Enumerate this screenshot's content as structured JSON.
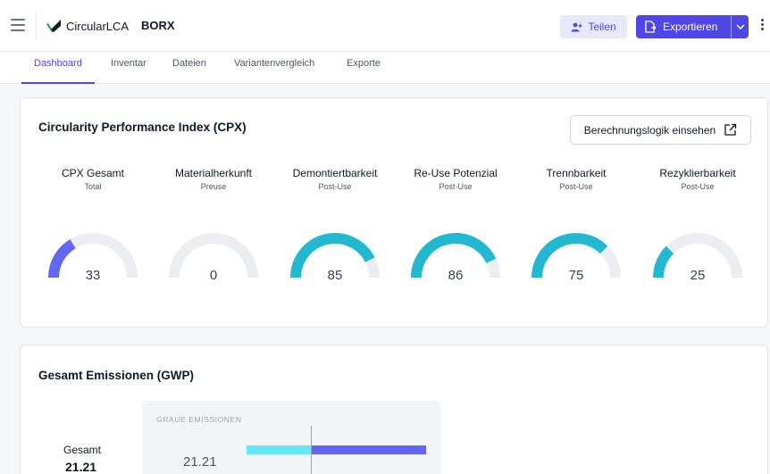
{
  "header": {
    "app_name": "CircularLCA",
    "project_name": "BORX",
    "share_label": "Teilen",
    "export_label": "Exportieren",
    "icons": [
      "menu-icon",
      "logo-icon",
      "share-user-icon",
      "export-file-icon",
      "chevron-down-icon",
      "more-vertical-icon"
    ],
    "accent_color": "#4f46e5"
  },
  "tabs": [
    {
      "label": "Dashboard",
      "active": true
    },
    {
      "label": "Inventar"
    },
    {
      "label": "Dateien"
    },
    {
      "label": "Variantenvergleich"
    },
    {
      "label": "Exporte"
    }
  ],
  "cpx": {
    "title": "Circularity Performance Index (CPX)",
    "logic_button": "Berechnungslogik einsehen",
    "gauges": [
      {
        "label": "CPX Gesamt",
        "sub": "Total",
        "value": "33",
        "color": "#6366f1"
      },
      {
        "label": "Materialherkunft",
        "sub": "Preuse",
        "value": "0",
        "color": "#22b8cf"
      },
      {
        "label": "Demontiertbarkeit",
        "sub": "Post-Use",
        "value": "85",
        "color": "#22b8cf"
      },
      {
        "label": "Re-Use Potenzial",
        "sub": "Post-Use",
        "value": "86",
        "color": "#22b8cf"
      },
      {
        "label": "Trennbarkeit",
        "sub": "Post-Use",
        "value": "75",
        "color": "#22b8cf"
      },
      {
        "label": "Rezyklierbarkeit",
        "sub": "Post-Use",
        "value": "25",
        "color": "#22b8cf"
      }
    ]
  },
  "emissions": {
    "title": "Gesamt Emissionen (GWP)",
    "gesamt_label": "Gesamt",
    "gesamt_value": "21.21",
    "panel_title": "GRAUE EMISSIONEN",
    "panel_value": "21.21"
  }
}
